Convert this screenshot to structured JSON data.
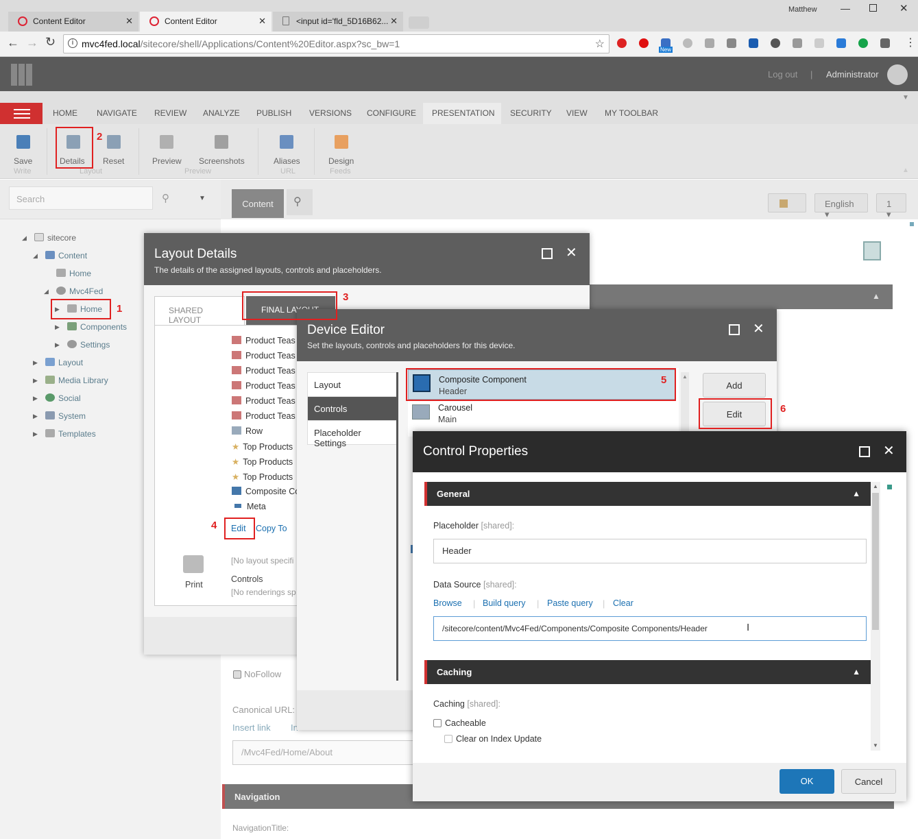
{
  "browser": {
    "user": "Matthew",
    "tabs": [
      "Content Editor",
      "Content Editor",
      "<input id='fld_5D16B62..."
    ],
    "url_host": "mvc4fed.local",
    "url_path": "/sitecore/shell/Applications/Content%20Editor.aspx?sc_bw=1",
    "ext_new": "New"
  },
  "header": {
    "logout": "Log out",
    "separator": "|",
    "user": "Administrator"
  },
  "ribbon": {
    "tabs": [
      "HOME",
      "NAVIGATE",
      "REVIEW",
      "ANALYZE",
      "PUBLISH",
      "VERSIONS",
      "CONFIGURE",
      "PRESENTATION",
      "SECURITY",
      "VIEW",
      "MY TOOLBAR"
    ],
    "buttons": [
      "Save",
      "Details",
      "Reset",
      "Preview",
      "Screenshots",
      "Aliases",
      "Design"
    ],
    "groups": [
      "Write",
      "Layout",
      "Preview",
      "URL",
      "Feeds"
    ]
  },
  "search": {
    "placeholder": "Search"
  },
  "tree": {
    "sitecore": "sitecore",
    "content": "Content",
    "home1": "Home",
    "mvc4fed": "Mvc4Fed",
    "home2": "Home",
    "components": "Components",
    "settings": "Settings",
    "layout": "Layout",
    "media": "Media Library",
    "social": "Social",
    "system": "System",
    "templates": "Templates"
  },
  "editor": {
    "content_tab": "Content",
    "language": "English",
    "version": "1",
    "nofollow": "NoFollow",
    "canonical_label": "Canonical URL:",
    "insert_link": "Insert link",
    "insert_link2": "In",
    "canonical_value": "/Mvc4Fed/Home/About",
    "navigation_header": "Navigation",
    "navigation_title": "NavigationTitle:"
  },
  "layout_details": {
    "title": "Layout Details",
    "subtitle": "The details of the assigned layouts, controls and placeholders.",
    "tabs": [
      "SHARED LAYOUT",
      "FINAL LAYOUT"
    ],
    "renderings": [
      "Product Teas",
      "Product Teas",
      "Product Teas",
      "Product Teas",
      "Product Teas",
      "Product Teas",
      "Row",
      "Top Products",
      "Top Products",
      "Top Products",
      "Composite Co",
      "Meta"
    ],
    "edit": "Edit",
    "copy_to": "Copy To",
    "print": "Print",
    "no_layout": "[No layout specifi",
    "controls_label": "Controls",
    "no_renderings": "[No renderings sp"
  },
  "device_editor": {
    "title": "Device Editor",
    "subtitle": "Set the layouts, controls and placeholders for this device.",
    "menu": [
      "Layout",
      "Controls",
      "Placeholder Settings"
    ],
    "items": [
      {
        "name": "Composite Component",
        "placeholder": "Header"
      },
      {
        "name": "Carousel",
        "placeholder": "Main"
      }
    ],
    "add": "Add",
    "edit": "Edit"
  },
  "control_properties": {
    "title": "Control Properties",
    "general": "General",
    "placeholder_label": "Placeholder",
    "shared": "[shared]:",
    "placeholder_value": "Header",
    "datasource_label": "Data Source",
    "links": [
      "Browse",
      "Build query",
      "Paste query",
      "Clear"
    ],
    "datasource_value": "/sitecore/content/Mvc4Fed/Components/Composite Components/Header",
    "caching": "Caching",
    "caching_label": "Caching",
    "cacheable": "Cacheable",
    "clear_on_index": "Clear on Index Update",
    "ok": "OK",
    "cancel": "Cancel"
  },
  "annotations": [
    "1",
    "2",
    "3",
    "4",
    "5",
    "6"
  ],
  "colors": {
    "accent": "#e02020",
    "sitecore_red": "#d03030",
    "ok_blue": "#1d76b8"
  }
}
